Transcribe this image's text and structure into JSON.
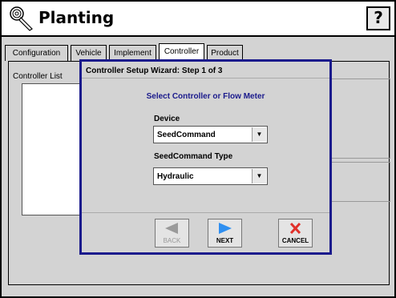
{
  "header": {
    "title": "Planting",
    "help_label": "?",
    "icon": "seed-tool-icon"
  },
  "tabs": [
    {
      "label": "Configuration",
      "active": false
    },
    {
      "label": "Vehicle",
      "active": false
    },
    {
      "label": "Implement",
      "active": false
    },
    {
      "label": "Controller",
      "active": true
    },
    {
      "label": "Product",
      "active": false
    }
  ],
  "panel": {
    "controller_list_label": "Controller List"
  },
  "dialog": {
    "title": "Controller Setup Wizard:  Step 1 of 3",
    "subtitle": "Select Controller or Flow Meter",
    "device": {
      "label": "Device",
      "value": "SeedCommand"
    },
    "type": {
      "label": "SeedCommand Type",
      "value": "Hydraulic"
    },
    "buttons": {
      "back": {
        "label": "BACK",
        "enabled": false,
        "icon": "left-arrow-icon"
      },
      "next": {
        "label": "NEXT",
        "enabled": true,
        "icon": "right-arrow-icon"
      },
      "cancel": {
        "label": "CANCEL",
        "enabled": true,
        "icon": "red-x-icon"
      }
    }
  },
  "colors": {
    "dialog_border": "#1a1a8c",
    "subtitle": "#1a1a8c",
    "next_arrow": "#2f8ff0",
    "cancel_x": "#e0302a",
    "back_arrow": "#9a9a9a"
  }
}
